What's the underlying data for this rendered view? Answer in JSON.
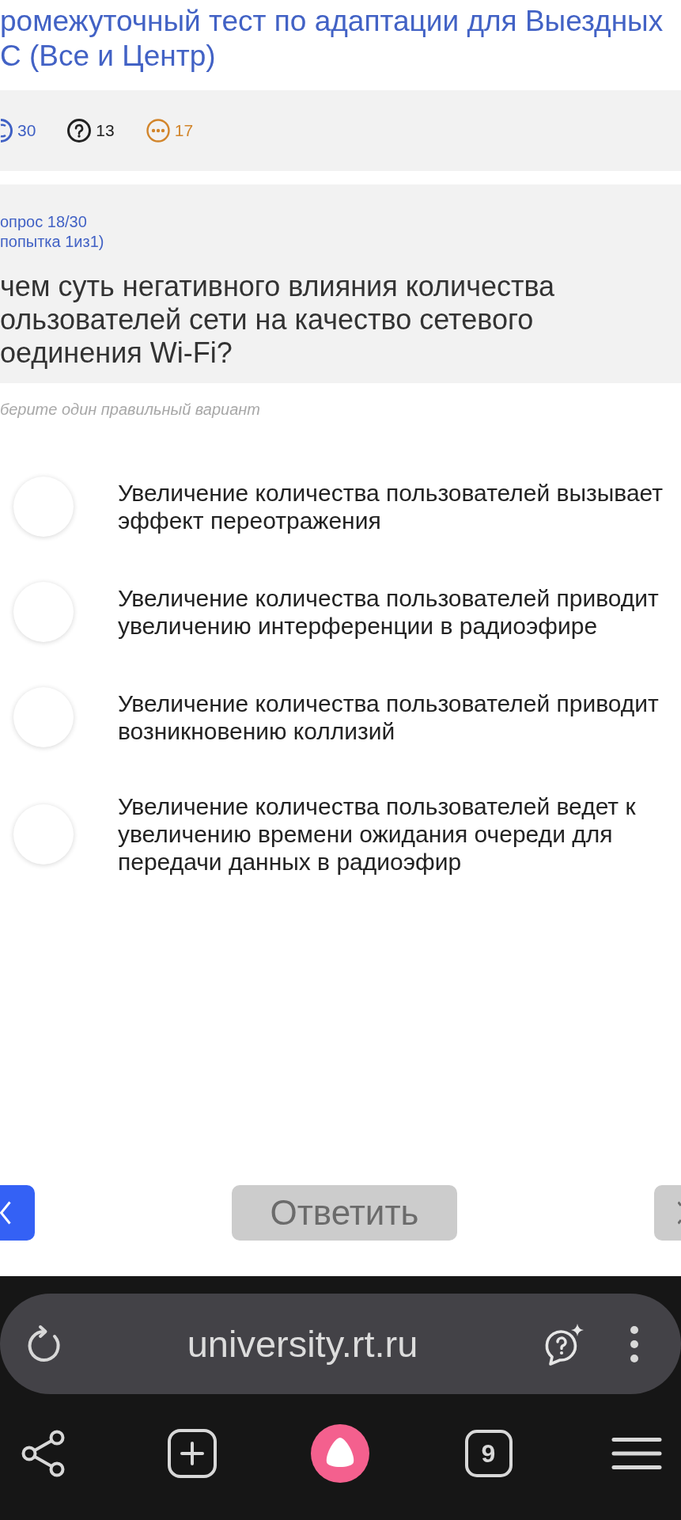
{
  "title": {
    "lines": [
      "ромежуточный тест по адаптации для Выездных",
      "С (Все и Центр)"
    ]
  },
  "stats": [
    {
      "kind": "circled",
      "value": "30",
      "color": "#3f60c4"
    },
    {
      "kind": "question",
      "value": "13",
      "color": "#222222"
    },
    {
      "kind": "ellipsis",
      "value": "17",
      "color": "#d2852b"
    }
  ],
  "question": {
    "number": "опрос 18/30",
    "attempt": "попытка 1из1)",
    "lines": [
      "чем суть негативного влияния количества",
      "ользователей сети на качество сетевого",
      "оединения Wi-Fi?"
    ],
    "hint": "берите один правильный вариант"
  },
  "options": [
    {
      "lines": [
        "Увеличение количества пользователей вызывает",
        "эффект переотражения"
      ],
      "selected": false
    },
    {
      "lines": [
        "Увеличение количества пользователей приводит",
        "увеличению интерференции в радиоэфире"
      ],
      "selected": false
    },
    {
      "lines": [
        "Увеличение количества пользователей приводит",
        "возникновению коллизий"
      ],
      "selected": false
    },
    {
      "lines": [
        "Увеличение количества пользователей ведет к",
        "увеличению времени ожидания очереди для",
        "передачи данных в радиоэфир"
      ],
      "selected": false
    }
  ],
  "navigation": {
    "previous": {
      "disabled": false
    },
    "submit": {
      "label": "Ответить",
      "disabled": true
    },
    "next": {
      "disabled": true
    }
  },
  "browser": {
    "url": "university.rt.ru",
    "tab_count": "9"
  }
}
